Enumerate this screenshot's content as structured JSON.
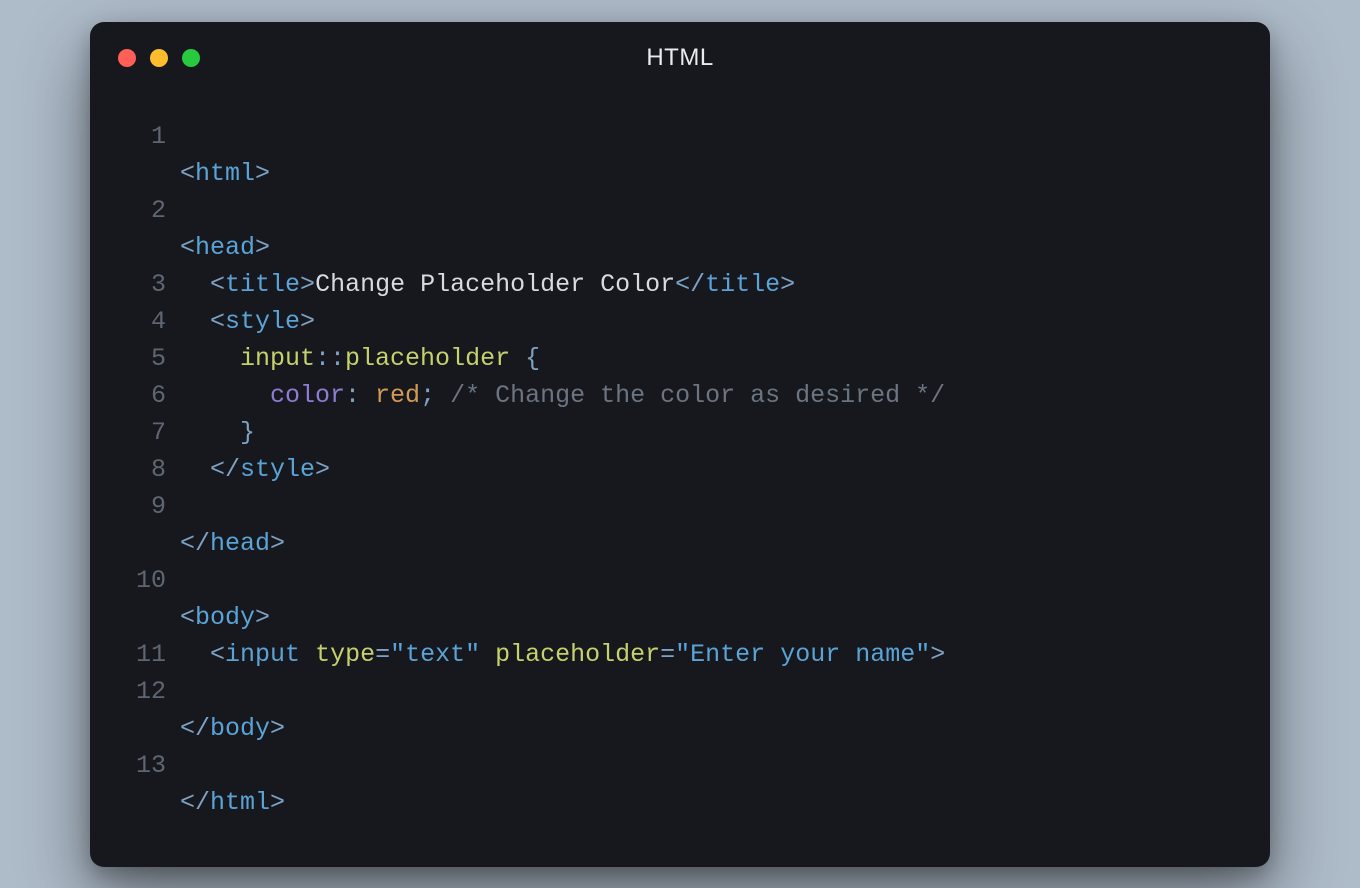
{
  "window": {
    "title": "HTML"
  },
  "gutter": [
    "1",
    "2",
    "3",
    "4",
    "5",
    "6",
    "7",
    "8",
    "9",
    "10",
    "11",
    "12",
    "13"
  ],
  "code": {
    "l1": {
      "lt": "<",
      "tag": "html",
      "gt": ">"
    },
    "l2": {
      "lt": "<",
      "tag": "head",
      "gt": ">"
    },
    "l3": {
      "indent": "  ",
      "lt": "<",
      "tag": "title",
      "gt": ">",
      "text": "Change Placeholder Color",
      "lt2": "</",
      "tag2": "title",
      "gt2": ">"
    },
    "l4": {
      "indent": "  ",
      "lt": "<",
      "tag": "style",
      "gt": ">"
    },
    "l5": {
      "indent": "    ",
      "sel": "input",
      "cc": "::",
      "pseudo": "placeholder",
      "sp": " ",
      "brace": "{"
    },
    "l6": {
      "indent": "      ",
      "prop": "color",
      "colon": ": ",
      "val": "red",
      "semi": ";",
      "sp": " ",
      "comment": "/* Change the color as desired */"
    },
    "l7": {
      "indent": "    ",
      "brace": "}"
    },
    "l8": {
      "indent": "  ",
      "lt": "</",
      "tag": "style",
      "gt": ">"
    },
    "l9": {
      "lt": "</",
      "tag": "head",
      "gt": ">"
    },
    "l10": {
      "lt": "<",
      "tag": "body",
      "gt": ">"
    },
    "l11": {
      "indent": "  ",
      "lt": "<",
      "tag": "input",
      "sp": " ",
      "attr1": "type",
      "eq1": "=",
      "str1": "\"text\"",
      "sp2": " ",
      "attr2": "placeholder",
      "eq2": "=",
      "str2": "\"Enter your name\"",
      "gt": ">"
    },
    "l12": {
      "lt": "</",
      "tag": "body",
      "gt": ">"
    },
    "l13": {
      "lt": "</",
      "tag": "html",
      "gt": ">"
    }
  }
}
